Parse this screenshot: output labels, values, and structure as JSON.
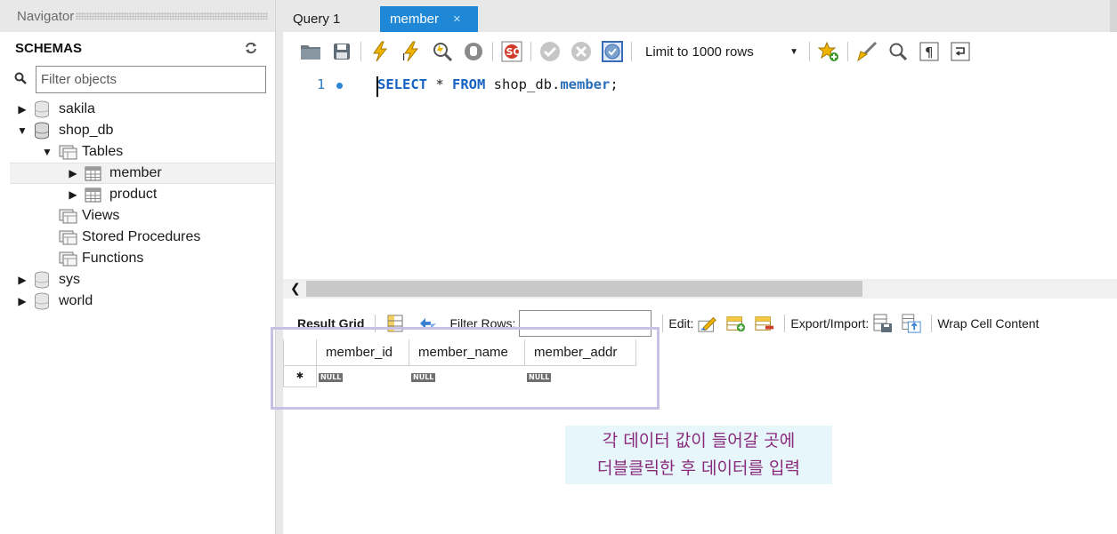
{
  "navigator": {
    "header": "Navigator",
    "schemas_title": "SCHEMAS",
    "filter_placeholder": "Filter objects",
    "tree": {
      "sakila": "sakila",
      "shop_db": "shop_db",
      "tables": "Tables",
      "member": "member",
      "product": "product",
      "views": "Views",
      "stored_procedures": "Stored Procedures",
      "functions": "Functions",
      "sys": "sys",
      "world": "world"
    }
  },
  "tabs": {
    "query1": "Query 1",
    "member": "member",
    "close": "×"
  },
  "toolbar": {
    "limit_label": "Limit to 1000 rows"
  },
  "editor": {
    "line_number": "1",
    "kw_select": "SELECT",
    "star": " * ",
    "kw_from": "FROM",
    "schema": " shop_db.",
    "table": "member",
    "semicolon": ";"
  },
  "result_toolbar": {
    "result_grid": "Result Grid",
    "filter_rows": "Filter Rows:",
    "edit": "Edit:",
    "export_import": "Export/Import:",
    "wrap_cell": "Wrap Cell Content"
  },
  "grid": {
    "columns": [
      "member_id",
      "member_name",
      "member_addr"
    ],
    "null_label": "NULL",
    "new_row_marker": "✱"
  },
  "annotation": {
    "line1": "각 데이터 값이 들어갈 곳에",
    "line2": "더블클릭한 후 데이터를 입력"
  },
  "colors": {
    "active_tab": "#1e88d6",
    "keyword": "#1763c4",
    "annotation_text": "#8a2a7d",
    "annotation_bg": "#e7f6fb",
    "highlight_border": "#c7c2e4"
  }
}
